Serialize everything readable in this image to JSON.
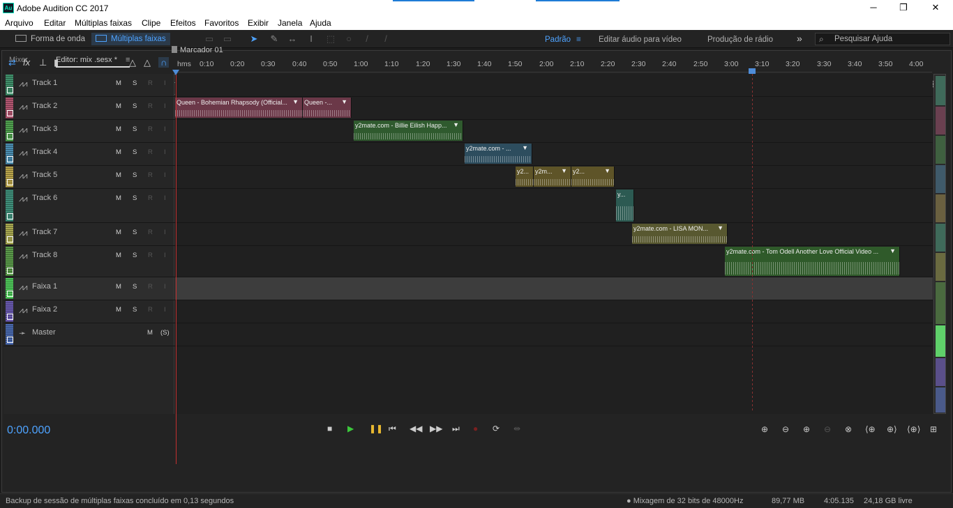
{
  "titlebar": {
    "logo": "Au",
    "title": "Adobe Audition CC 2017",
    "minimize": "─",
    "maximize": "❐",
    "close": "✕"
  },
  "menu": [
    "Arquivo",
    "Editar",
    "Múltiplas faixas",
    "Clipe",
    "Efeitos",
    "Favoritos",
    "Exibir",
    "Janela",
    "Ajuda"
  ],
  "toolbar": {
    "waveform_label": "Forma de onda",
    "multitrack_label": "Múltiplas faixas"
  },
  "workspaces": {
    "padrao": "Padrão",
    "editar_video": "Editar áudio para vídeo",
    "radio": "Produção de rádio",
    "more": "»"
  },
  "search": {
    "placeholder": "Pesquisar Ajuda"
  },
  "tabs": {
    "mixer": "Mixer",
    "editor": "Editor: mix .sesx *",
    "menu": "≡"
  },
  "marker": {
    "label": "Marcador 01"
  },
  "ruler": {
    "unit": "hms",
    "ticks": [
      "0:10",
      "0:20",
      "0:30",
      "0:40",
      "0:50",
      "1:00",
      "1:10",
      "1:20",
      "1:30",
      "1:40",
      "1:50",
      "2:00",
      "2:10",
      "2:20",
      "2:30",
      "2:40",
      "2:50",
      "3:00",
      "3:10",
      "3:20",
      "3:30",
      "3:40",
      "3:50",
      "4:00"
    ]
  },
  "tracks": [
    {
      "name": "Track 1",
      "color": "#3f8f6a",
      "m": "M",
      "s": "S",
      "r": "R",
      "i": "I"
    },
    {
      "name": "Track 2",
      "color": "#b0546f",
      "m": "M",
      "s": "S",
      "r": "R",
      "i": "I"
    },
    {
      "name": "Track 3",
      "color": "#4fa04e",
      "m": "M",
      "s": "S",
      "r": "R",
      "i": "I"
    },
    {
      "name": "Track 4",
      "color": "#4a8db0",
      "m": "M",
      "s": "S",
      "r": "R",
      "i": "I"
    },
    {
      "name": "Track 5",
      "color": "#b8a34a",
      "m": "M",
      "s": "S",
      "r": "R",
      "i": "I"
    },
    {
      "name": "Track 6",
      "color": "#3f8f7a",
      "m": "M",
      "s": "S",
      "r": "R",
      "i": "I"
    },
    {
      "name": "Track 7",
      "color": "#a8a850",
      "m": "M",
      "s": "S",
      "r": "R",
      "i": "I"
    },
    {
      "name": "Track 8",
      "color": "#5a9a4a",
      "m": "M",
      "s": "S",
      "r": "R",
      "i": "I"
    },
    {
      "name": "Faixa 1",
      "color": "#4fc85a",
      "m": "M",
      "s": "S",
      "r": "R",
      "i": "I"
    },
    {
      "name": "Faixa 2",
      "color": "#6a5ab0",
      "m": "M",
      "s": "S",
      "r": "R",
      "i": "I"
    },
    {
      "name": "Master",
      "color": "#4a6ab0",
      "m": "M",
      "s": "(S)",
      "r": "",
      "i": ""
    }
  ],
  "clips": {
    "t2a": "Queen - Bohemian Rhapsody (Official...",
    "t2b": "Queen -...",
    "t3": "y2mate.com - Billie Eilish  Happ...",
    "t4": "y2mate.com - ...",
    "t5a": "y2...",
    "t5b": "y2m...",
    "t5c": "y2...",
    "t6": "y...",
    "t7": "y2mate.com - LISA  MON...",
    "t8": "y2mate.com - Tom Odell  Another Love Official Video ..."
  },
  "transport": {
    "timecode": "0:00.000"
  },
  "status": {
    "message": "Backup de sessão de múltiplas faixas concluído em 0,13 segundos",
    "mix": "● Mixagem de 32 bits de 48000Hz",
    "size": "89,77 MB",
    "duration": "4:05.135",
    "free": "24,18 GB livre"
  }
}
